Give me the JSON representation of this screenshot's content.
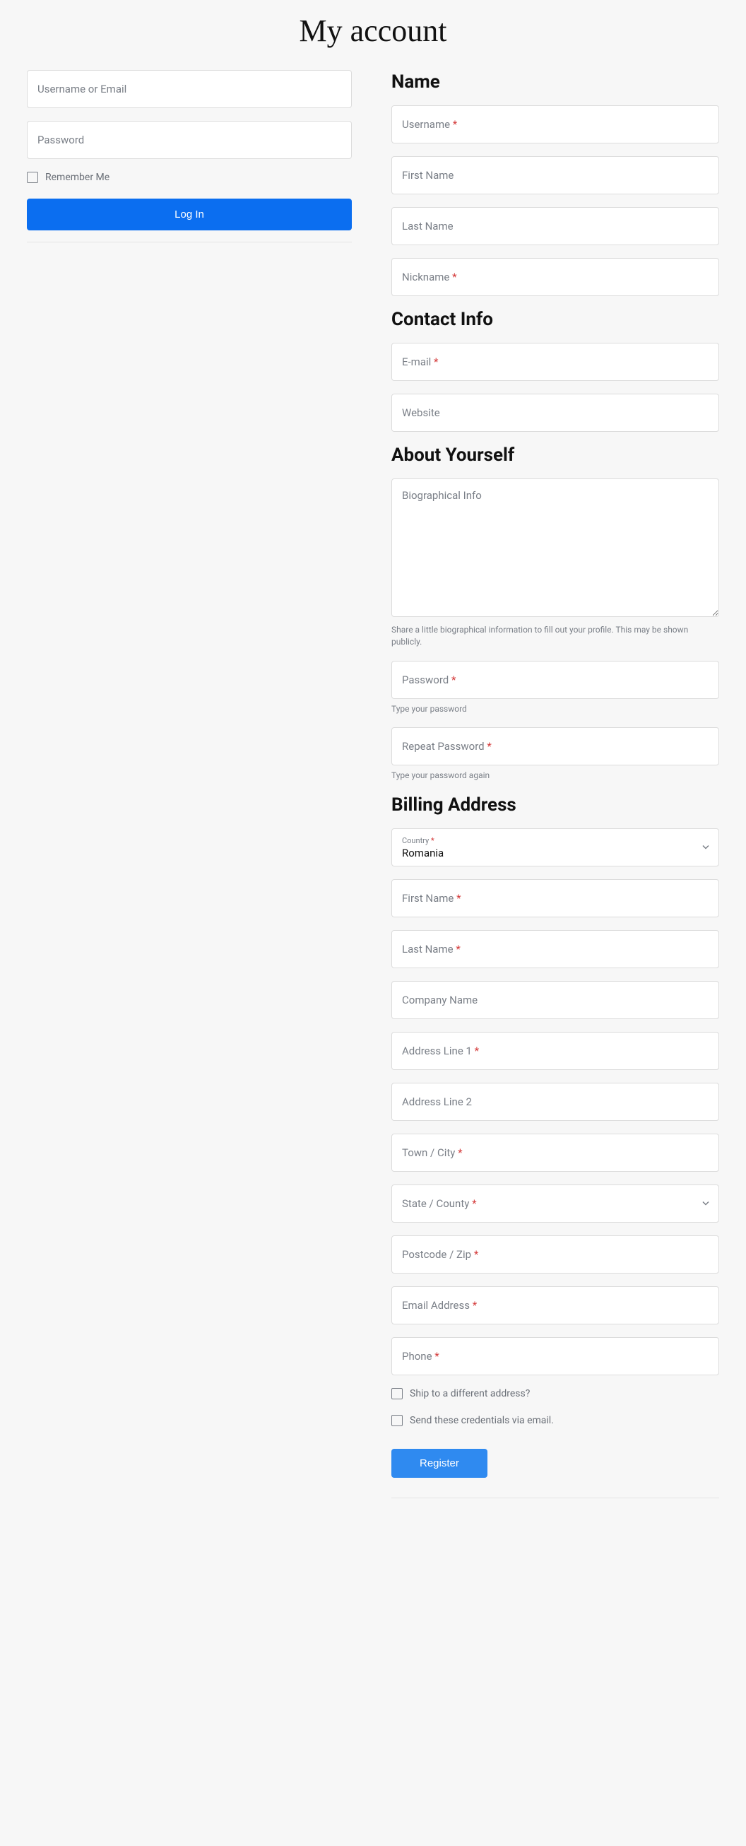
{
  "page": {
    "title": "My account"
  },
  "login": {
    "username_ph": "Username or Email",
    "password_ph": "Password",
    "remember": "Remember Me",
    "button": "Log In"
  },
  "sections": {
    "name": "Name",
    "contact": "Contact Info",
    "about": "About Yourself",
    "billing": "Billing Address"
  },
  "reg": {
    "username": "Username",
    "first_name": "First Name",
    "last_name": "Last Name",
    "nickname": "Nickname",
    "email": "E-mail",
    "website": "Website",
    "bio_ph": "Biographical Info",
    "bio_help": "Share a little biographical information to fill out your profile. This may be shown publicly.",
    "password": "Password",
    "password_help": "Type your password",
    "repeat_password": "Repeat Password",
    "repeat_password_help": "Type your password again",
    "country_label": "Country",
    "country_value": "Romania",
    "b_first_name": "First Name",
    "b_last_name": "Last Name",
    "company": "Company Name",
    "addr1": "Address Line 1",
    "addr2": "Address Line 2",
    "city": "Town / City",
    "state": "State / County",
    "postcode": "Postcode / Zip",
    "b_email": "Email Address",
    "phone": "Phone",
    "ship_diff": "Ship to a different address?",
    "send_creds": "Send these credentials via email.",
    "button": "Register",
    "star": "*"
  }
}
